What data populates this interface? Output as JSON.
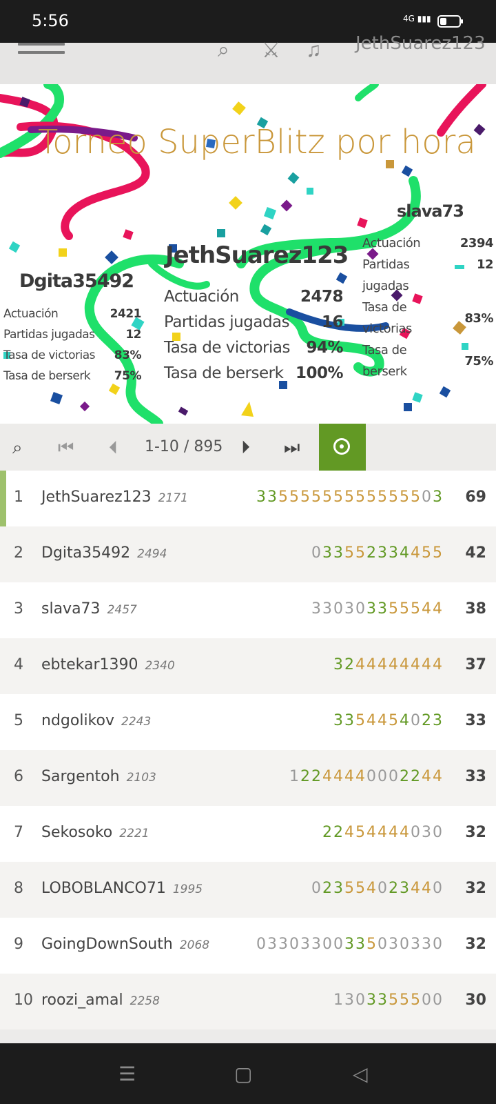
{
  "status_bar": {
    "time": "5:56",
    "network": "4G"
  },
  "app_header": {
    "username": "JethSuarez123",
    "menu_icon": "hamburger-icon",
    "search_icon": "search-icon",
    "swords_icon": "crossed-swords-icon",
    "bell_icon": "bell-icon"
  },
  "podium": {
    "title": "Torneo SuperBlitz por hora",
    "first": {
      "name": "JethSuarez123",
      "stats": [
        {
          "label": "Actuación",
          "value": "2478"
        },
        {
          "label": "Partidas jugadas",
          "value": "16"
        },
        {
          "label": "Tasa de victorias",
          "value": "94%"
        },
        {
          "label": "Tasa de berserk",
          "value": "100%"
        }
      ]
    },
    "second": {
      "name": "Dgita35492",
      "stats": [
        {
          "label": "Actuación",
          "value": "2421"
        },
        {
          "label": "Partidas jugadas",
          "value": "12"
        },
        {
          "label": "Tasa de victorias",
          "value": "83%"
        },
        {
          "label": "Tasa de berserk",
          "value": "75%"
        }
      ]
    },
    "third": {
      "name": "slava73",
      "stats": [
        {
          "label": "Actuación",
          "value": "2394"
        },
        {
          "label": "Partidas jugadas",
          "value": "12"
        },
        {
          "label": "Tasa de victorias",
          "value": "83%"
        },
        {
          "label": "Tasa de berserk",
          "value": "75%"
        }
      ]
    }
  },
  "pager": {
    "range": "1-10 / 895"
  },
  "standings": [
    {
      "rank": "1",
      "name": "JethSuarez123",
      "rating": "2171",
      "sheet": [
        [
          "g",
          "33"
        ],
        [
          "o",
          "5555555555555"
        ],
        [
          "n",
          "0"
        ],
        [
          "g",
          "3"
        ]
      ],
      "score": "69",
      "me": true
    },
    {
      "rank": "2",
      "name": "Dgita35492",
      "rating": "2494",
      "sheet": [
        [
          "n",
          "0"
        ],
        [
          "g",
          "33"
        ],
        [
          "o",
          "55"
        ],
        [
          "g",
          "2334"
        ],
        [
          "o",
          "455"
        ]
      ],
      "score": "42"
    },
    {
      "rank": "3",
      "name": "slava73",
      "rating": "2457",
      "sheet": [
        [
          "n",
          "33030"
        ],
        [
          "g",
          "33"
        ],
        [
          "o",
          "55544"
        ]
      ],
      "score": "38"
    },
    {
      "rank": "4",
      "name": "ebtekar1390",
      "rating": "2340",
      "sheet": [
        [
          "g",
          "32"
        ],
        [
          "o",
          "44444444"
        ]
      ],
      "score": "37"
    },
    {
      "rank": "5",
      "name": "ndgolikov",
      "rating": "2243",
      "sheet": [
        [
          "g",
          "33"
        ],
        [
          "o",
          "5445"
        ],
        [
          "g",
          "4"
        ],
        [
          "n",
          "0"
        ],
        [
          "g",
          "23"
        ]
      ],
      "score": "33"
    },
    {
      "rank": "6",
      "name": "Sargentoh",
      "rating": "2103",
      "sheet": [
        [
          "n",
          "1"
        ],
        [
          "g",
          "22"
        ],
        [
          "o",
          "4444"
        ],
        [
          "n",
          "000"
        ],
        [
          "g",
          "22"
        ],
        [
          "o",
          "44"
        ]
      ],
      "score": "33"
    },
    {
      "rank": "7",
      "name": "Sekosoko",
      "rating": "2221",
      "sheet": [
        [
          "g",
          "22"
        ],
        [
          "o",
          "454444"
        ],
        [
          "n",
          "030"
        ]
      ],
      "score": "32"
    },
    {
      "rank": "8",
      "name": "LOBOBLANCO71",
      "rating": "1995",
      "sheet": [
        [
          "n",
          "0"
        ],
        [
          "g",
          "23"
        ],
        [
          "o",
          "554"
        ],
        [
          "n",
          "0"
        ],
        [
          "g",
          "23"
        ],
        [
          "o",
          "44"
        ],
        [
          "n",
          "0"
        ]
      ],
      "score": "32"
    },
    {
      "rank": "9",
      "name": "GoingDownSouth",
      "rating": "2068",
      "sheet": [
        [
          "n",
          "03303300"
        ],
        [
          "g",
          "33"
        ],
        [
          "o",
          "5"
        ],
        [
          "n",
          "030330"
        ]
      ],
      "score": "32"
    },
    {
      "rank": "10",
      "name": "roozi_amal",
      "rating": "2258",
      "sheet": [
        [
          "n",
          "130"
        ],
        [
          "g",
          "33"
        ],
        [
          "o",
          "555"
        ],
        [
          "n",
          "00"
        ]
      ],
      "score": "30"
    }
  ],
  "colors": {
    "accent_green": "#629924",
    "accent_orange": "#c9973a"
  }
}
